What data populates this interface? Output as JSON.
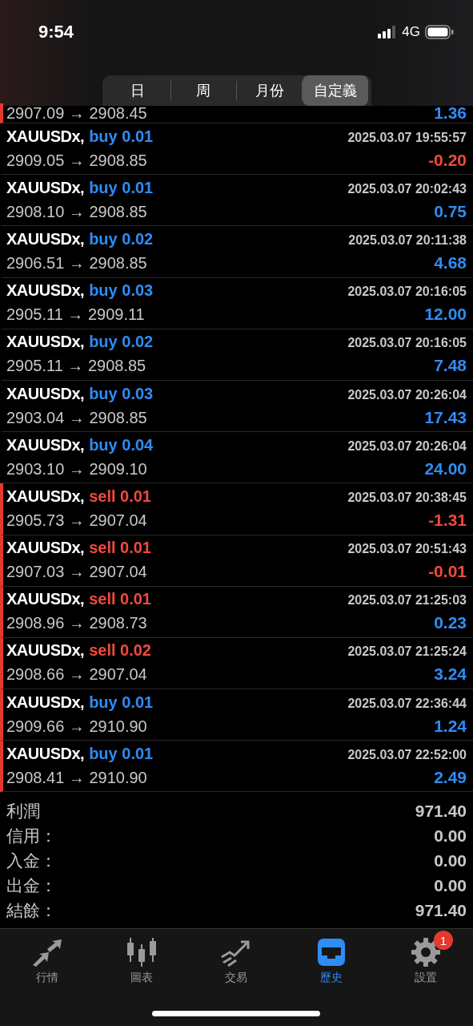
{
  "status_bar": {
    "time": "9:54",
    "network": "4G"
  },
  "period_tabs": [
    {
      "label": "日",
      "selected": false
    },
    {
      "label": "周",
      "selected": false
    },
    {
      "label": "月份",
      "selected": false
    },
    {
      "label": "自定義",
      "selected": true
    }
  ],
  "partial_row": {
    "prices": "2907.09 → 2908.45",
    "profit": "1.36",
    "loss": false,
    "flagged": true
  },
  "deals": [
    {
      "symbol": "XAUUSDx,",
      "kind": "buy",
      "order": "buy 0.01",
      "time": "2025.03.07 19:55:57",
      "prices": "2909.05 → 2908.85",
      "profit": "-0.20",
      "loss": true,
      "flagged": false
    },
    {
      "symbol": "XAUUSDx,",
      "kind": "buy",
      "order": "buy 0.01",
      "time": "2025.03.07 20:02:43",
      "prices": "2908.10 → 2908.85",
      "profit": "0.75",
      "loss": false,
      "flagged": false
    },
    {
      "symbol": "XAUUSDx,",
      "kind": "buy",
      "order": "buy 0.02",
      "time": "2025.03.07 20:11:38",
      "prices": "2906.51 → 2908.85",
      "profit": "4.68",
      "loss": false,
      "flagged": false
    },
    {
      "symbol": "XAUUSDx,",
      "kind": "buy",
      "order": "buy 0.03",
      "time": "2025.03.07 20:16:05",
      "prices": "2905.11 → 2909.11",
      "profit": "12.00",
      "loss": false,
      "flagged": false
    },
    {
      "symbol": "XAUUSDx,",
      "kind": "buy",
      "order": "buy 0.02",
      "time": "2025.03.07 20:16:05",
      "prices": "2905.11 → 2908.85",
      "profit": "7.48",
      "loss": false,
      "flagged": false
    },
    {
      "symbol": "XAUUSDx,",
      "kind": "buy",
      "order": "buy 0.03",
      "time": "2025.03.07 20:26:04",
      "prices": "2903.04 → 2908.85",
      "profit": "17.43",
      "loss": false,
      "flagged": false
    },
    {
      "symbol": "XAUUSDx,",
      "kind": "buy",
      "order": "buy 0.04",
      "time": "2025.03.07 20:26:04",
      "prices": "2903.10 → 2909.10",
      "profit": "24.00",
      "loss": false,
      "flagged": false
    },
    {
      "symbol": "XAUUSDx,",
      "kind": "sell",
      "order": "sell 0.01",
      "time": "2025.03.07 20:38:45",
      "prices": "2905.73 → 2907.04",
      "profit": "-1.31",
      "loss": true,
      "flagged": true
    },
    {
      "symbol": "XAUUSDx,",
      "kind": "sell",
      "order": "sell 0.01",
      "time": "2025.03.07 20:51:43",
      "prices": "2907.03 → 2907.04",
      "profit": "-0.01",
      "loss": true,
      "flagged": true
    },
    {
      "symbol": "XAUUSDx,",
      "kind": "sell",
      "order": "sell 0.01",
      "time": "2025.03.07 21:25:03",
      "prices": "2908.96 → 2908.73",
      "profit": "0.23",
      "loss": false,
      "flagged": true
    },
    {
      "symbol": "XAUUSDx,",
      "kind": "sell",
      "order": "sell 0.02",
      "time": "2025.03.07 21:25:24",
      "prices": "2908.66 → 2907.04",
      "profit": "3.24",
      "loss": false,
      "flagged": true
    },
    {
      "symbol": "XAUUSDx,",
      "kind": "buy",
      "order": "buy 0.01",
      "time": "2025.03.07 22:36:44",
      "prices": "2909.66 → 2910.90",
      "profit": "1.24",
      "loss": false,
      "flagged": true
    },
    {
      "symbol": "XAUUSDx,",
      "kind": "buy",
      "order": "buy 0.01",
      "time": "2025.03.07 22:52:00",
      "prices": "2908.41 → 2910.90",
      "profit": "2.49",
      "loss": false,
      "flagged": true
    }
  ],
  "summary": [
    {
      "label": "利潤",
      "value": "971.40"
    },
    {
      "label": "信用：",
      "value": "0.00"
    },
    {
      "label": "入金：",
      "value": "0.00"
    },
    {
      "label": "出金：",
      "value": "0.00"
    },
    {
      "label": "結餘：",
      "value": "971.40"
    }
  ],
  "tab_bar": [
    {
      "kind": "quotes",
      "label": "行情",
      "selected": false
    },
    {
      "kind": "chart",
      "label": "圖表",
      "selected": false
    },
    {
      "kind": "trade",
      "label": "交易",
      "selected": false
    },
    {
      "kind": "history",
      "label": "歷史",
      "selected": true
    },
    {
      "kind": "settings",
      "label": "設置",
      "selected": false,
      "badge": "1"
    }
  ]
}
